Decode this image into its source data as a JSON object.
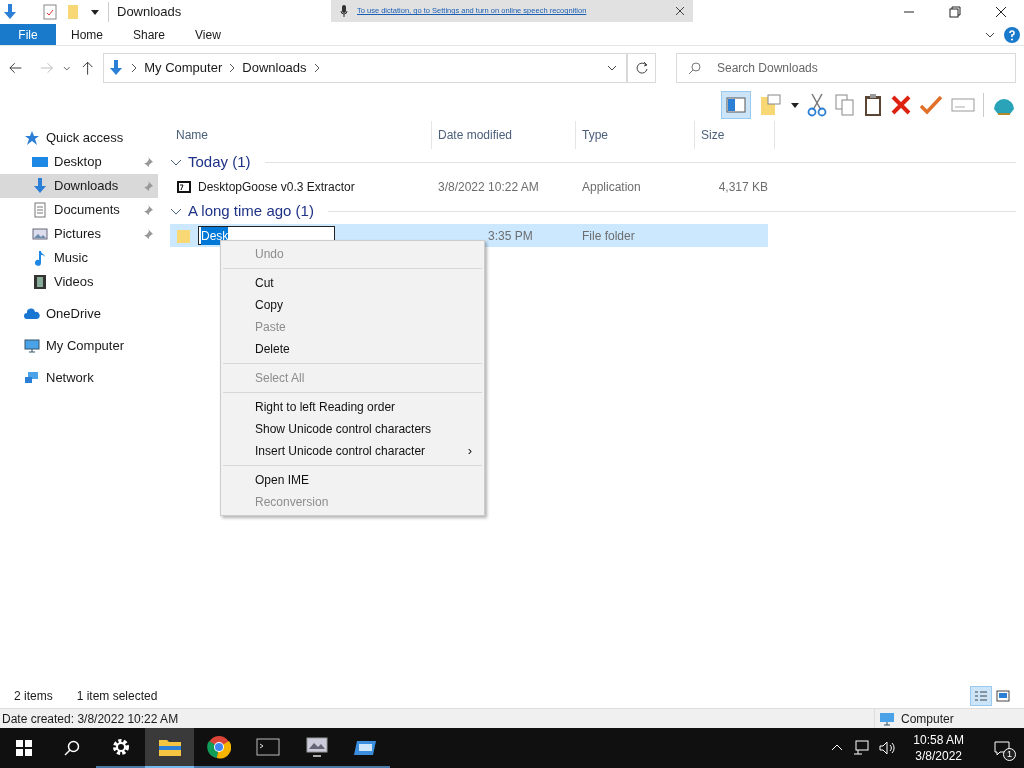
{
  "window": {
    "title": "Downloads"
  },
  "dictation_banner": {
    "text": "To use dictation, go to Settings and turn on online speech recognition"
  },
  "ribbon_tabs": [
    {
      "label": "File",
      "selected": true
    },
    {
      "label": "Home",
      "selected": false
    },
    {
      "label": "Share",
      "selected": false
    },
    {
      "label": "View",
      "selected": false
    }
  ],
  "address": {
    "path": [
      "My Computer",
      "Downloads"
    ]
  },
  "search": {
    "placeholder": "Search Downloads"
  },
  "sidebar": {
    "items": [
      {
        "label": "Quick access",
        "kind": "star",
        "pinned": false,
        "selected": false,
        "children": [
          {
            "label": "Desktop",
            "kind": "desktop",
            "pinned": true,
            "selected": false
          },
          {
            "label": "Downloads",
            "kind": "download",
            "pinned": true,
            "selected": true
          },
          {
            "label": "Documents",
            "kind": "document",
            "pinned": true,
            "selected": false
          },
          {
            "label": "Pictures",
            "kind": "picture",
            "pinned": true,
            "selected": false
          },
          {
            "label": "Music",
            "kind": "music",
            "pinned": false,
            "selected": false
          },
          {
            "label": "Videos",
            "kind": "video",
            "pinned": false,
            "selected": false
          }
        ]
      },
      {
        "label": "OneDrive",
        "kind": "cloud",
        "pinned": false,
        "selected": false
      },
      {
        "label": "My Computer",
        "kind": "computer",
        "pinned": false,
        "selected": false
      },
      {
        "label": "Network",
        "kind": "network",
        "pinned": false,
        "selected": false
      }
    ]
  },
  "table": {
    "columns": [
      "Name",
      "Date modified",
      "Type",
      "Size"
    ],
    "groups": [
      {
        "title": "Today (1)",
        "rows": [
          {
            "kind": "archive",
            "name": "DesktopGoose v0.3 Extractor",
            "editing": false,
            "date": "3/8/2022 10:22 AM",
            "type": "Application",
            "size": "4,317 KB",
            "selected": false
          }
        ]
      },
      {
        "title": "A long time ago (1)",
        "rows": [
          {
            "kind": "folder",
            "name": "Desk",
            "editing": true,
            "date": "3:35 PM",
            "type": "File folder",
            "selected": true
          }
        ]
      }
    ]
  },
  "context_menu": {
    "items": [
      {
        "kind": "item",
        "label": "Undo",
        "disabled": true
      },
      {
        "kind": "separator"
      },
      {
        "kind": "item",
        "label": "Cut",
        "disabled": false
      },
      {
        "kind": "item",
        "label": "Copy",
        "disabled": false
      },
      {
        "kind": "item",
        "label": "Paste",
        "disabled": true
      },
      {
        "kind": "item",
        "label": "Delete",
        "disabled": false
      },
      {
        "kind": "separator"
      },
      {
        "kind": "item",
        "label": "Select All",
        "disabled": true
      },
      {
        "kind": "separator"
      },
      {
        "kind": "item",
        "label": "Right to left Reading order",
        "disabled": false
      },
      {
        "kind": "item",
        "label": "Show Unicode control characters",
        "disabled": false
      },
      {
        "kind": "submenu",
        "label": "Insert Unicode control character",
        "arrow": "›",
        "disabled": false
      },
      {
        "kind": "separator"
      },
      {
        "kind": "item",
        "label": "Open IME",
        "disabled": false
      },
      {
        "kind": "item",
        "label": "Reconversion",
        "disabled": true
      }
    ]
  },
  "status_bar": {
    "items_count": "2 items",
    "selection": "1 item selected"
  },
  "details_bar": {
    "text": "Date created: 3/8/2022 10:22 AM",
    "location": "Computer"
  },
  "taskbar": {
    "apps": [
      {
        "kind": "settings",
        "active": false
      },
      {
        "kind": "explorer",
        "active": true
      },
      {
        "kind": "chrome",
        "active": false
      },
      {
        "kind": "terminal",
        "active": false
      },
      {
        "kind": "monitor",
        "active": false
      },
      {
        "kind": "window",
        "active": false
      }
    ],
    "time": "10:58 AM",
    "date": "3/8/2022",
    "notification_count": "1"
  }
}
